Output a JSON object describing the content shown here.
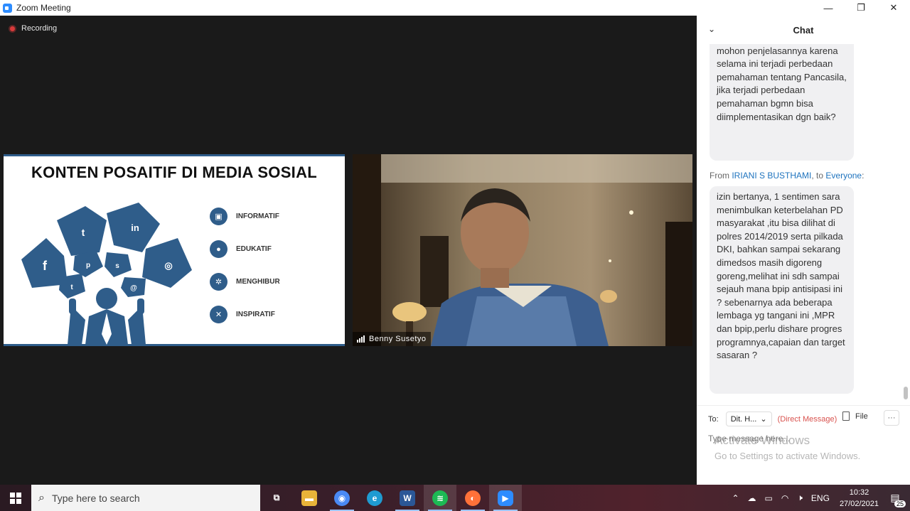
{
  "window": {
    "title": "Zoom Meeting",
    "minimize": "—",
    "maximize": "❐",
    "close": "✕"
  },
  "meeting": {
    "recording_label": "Recording",
    "slide": {
      "title": "KONTEN POSAITIF DI MEDIA SOSIAL",
      "items": [
        {
          "label": "INFORMATIF",
          "icon": "cube-icon"
        },
        {
          "label": "EDUKATIF",
          "icon": "microphone-icon"
        },
        {
          "label": "MENGHIBUR",
          "icon": "gears-icon"
        },
        {
          "label": "INSPIRATIF",
          "icon": "tools-icon"
        }
      ],
      "accent_color": "#2f5d8a"
    },
    "participant_name": "Benny Susetyo"
  },
  "chat": {
    "header": "Chat",
    "messages": [
      {
        "text": "TNI, Polri, DPD, MPR, DPR, mohon penjelasannya karena selama ini terjadi perbedaan pemahaman tentang Pancasila, jika terjadi perbedaan pemahaman bgmn bisa diimplementasikan dgn baik?"
      },
      {
        "from_prefix": "From",
        "sender": "IRIANI S BUSTHAMI",
        "to_prefix": ", to",
        "recipient": "Everyone",
        "suffix": ":",
        "text": "izin bertanya, 1 sentimen sara menimbulkan keterbelahan PD masyarakat ,itu bisa dilihat di polres 2014/2019 serta pilkada DKI, bahkan sampai sekarang dimedsos masih digoreng goreng,melihat ini sdh sampai sejauh mana bpip antisipasi ini ?  sebenarnya ada beberapa lembaga yg tangani ini ,MPR dan bpip,perlu dishare progres programnya,capaian dan target sasaran ?"
      }
    ],
    "compose": {
      "to_label": "To:",
      "recipient": "Dit. H...",
      "direct_message": "(Direct Message)",
      "file_label": "File",
      "more": "···",
      "placeholder": "Type message here..."
    }
  },
  "watermark": {
    "line1": "Activate Windows",
    "line2": "Go to Settings to activate Windows."
  },
  "taskbar": {
    "search_placeholder": "Type here to search",
    "apps": [
      {
        "name": "task-view",
        "glyph": "⧉",
        "color": "transparent"
      },
      {
        "name": "file-explorer",
        "glyph": "▬",
        "color": "#e8b339"
      },
      {
        "name": "chrome",
        "glyph": "◉",
        "color": "#4a8af4"
      },
      {
        "name": "edge",
        "glyph": "e",
        "color": "#1f9bd1"
      },
      {
        "name": "word",
        "glyph": "W",
        "color": "#2b5797"
      },
      {
        "name": "spotify",
        "glyph": "≋",
        "color": "#1db954"
      },
      {
        "name": "firefox",
        "glyph": "◐",
        "color": "#ff7139"
      },
      {
        "name": "zoom",
        "glyph": "▶",
        "color": "#2d8cff"
      }
    ],
    "language": "ENG",
    "time": "10:32",
    "date": "27/02/2021",
    "notification_count": "25"
  }
}
